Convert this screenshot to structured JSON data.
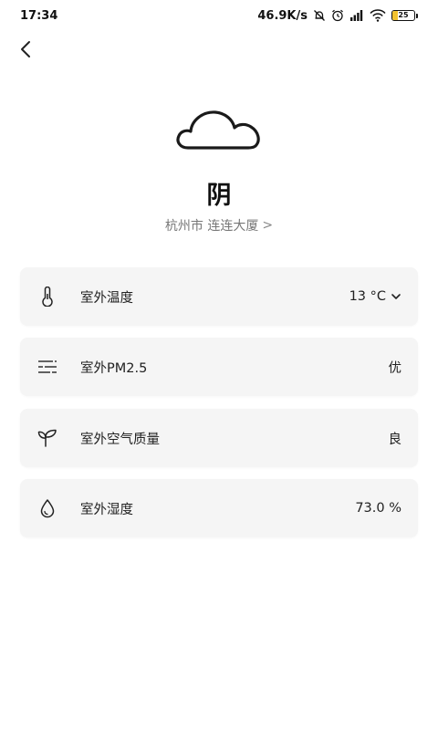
{
  "status_bar": {
    "time": "17:34",
    "net_speed": "46.9K/s",
    "battery_level": "25",
    "battery_fraction": 0.25,
    "icons": [
      "mute-bell-icon",
      "alarm-icon",
      "signal-icon",
      "wifi-icon",
      "battery-icon"
    ]
  },
  "header": {
    "back_icon": "chevron-left-icon",
    "weather_icon": "cloud-icon",
    "condition": "阴",
    "location": "杭州市 连连大厦",
    "location_chevron": ">"
  },
  "cards": [
    {
      "icon": "thermometer-icon",
      "label": "室外温度",
      "value": "13 °C",
      "has_dropdown": true
    },
    {
      "icon": "haze-icon",
      "label": "室外PM2.5",
      "value": "优"
    },
    {
      "icon": "sprout-icon",
      "label": "室外空气质量",
      "value": "良"
    },
    {
      "icon": "water-drop-icon",
      "label": "室外湿度",
      "value": "73.0 %"
    }
  ]
}
